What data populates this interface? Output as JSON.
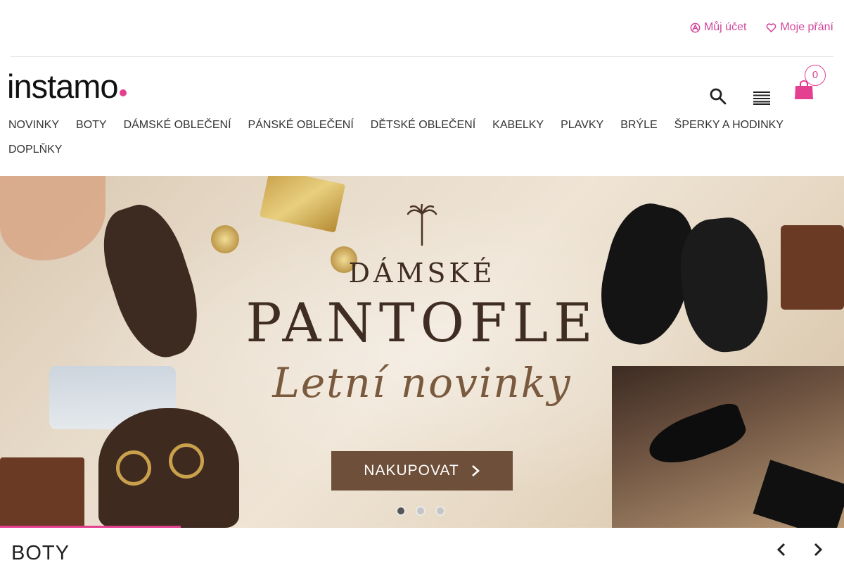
{
  "header": {
    "account_label": "Můj účet",
    "wishlist_label": "Moje přání",
    "logo_text": "instamo",
    "cart_count": "0"
  },
  "nav": {
    "row1": [
      "NOVINKY",
      "BOTY",
      "DÁMSKÉ OBLEČENÍ",
      "PÁNSKÉ OBLEČENÍ",
      "DĚTSKÉ OBLEČENÍ",
      "KABELKY",
      "PLAVKY",
      "BRÝLE",
      "ŠPERKY A HODINKY"
    ],
    "row2": [
      "DOPLŇKY"
    ]
  },
  "hero": {
    "subtitle": "DÁMSKÉ",
    "title": "PANTOFLE",
    "script": "Letní novinky",
    "button_label": "NAKUPOVAT",
    "slides_total": 3,
    "active_slide": 1
  },
  "section": {
    "title": "BOTY"
  },
  "colors": {
    "accent": "#e4408f",
    "link": "#d0449a",
    "button": "#6e4f3a"
  },
  "icons": [
    "account-icon",
    "heart-icon",
    "search-icon",
    "menu-icon",
    "shopping-bag-icon",
    "chevron-right-icon",
    "chevron-left-icon",
    "palm-icon"
  ]
}
